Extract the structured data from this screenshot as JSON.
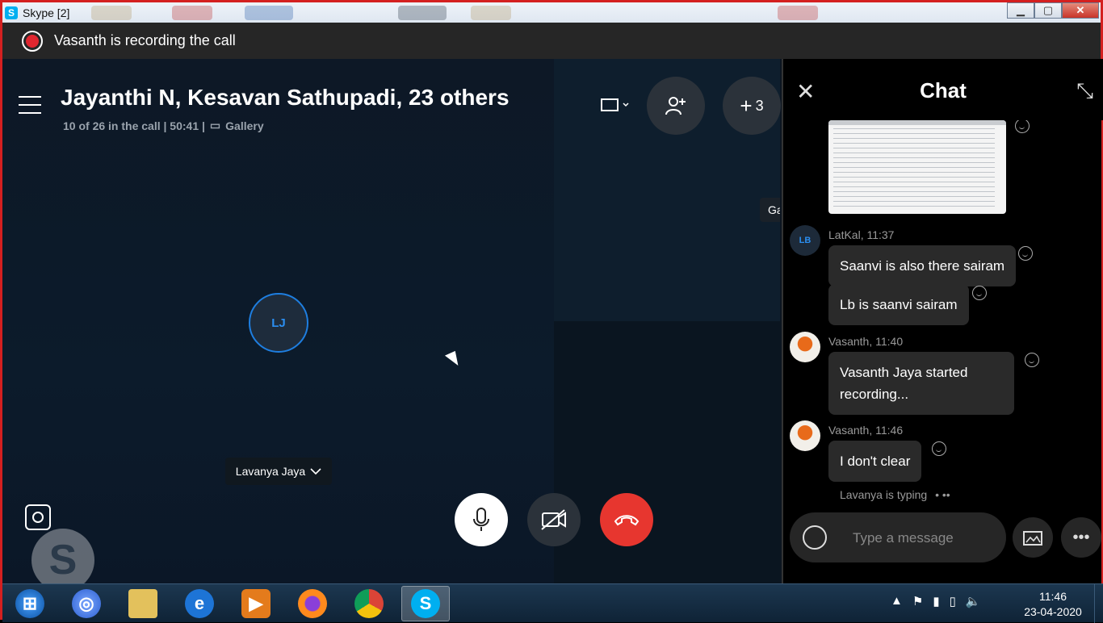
{
  "window": {
    "title": "Skype [2]",
    "minimize_label": "▁",
    "maximize_label": "▢",
    "close_label": "✕"
  },
  "recording": {
    "text": "Vasanth is recording the call"
  },
  "call": {
    "title": "Jayanthi N, Kesavan Sathupadi, 23 others",
    "participants_status": "10 of 26 in the call | 50:41 |",
    "view_mode": "Gallery",
    "extra_count": "3",
    "participant_initials": "LJ",
    "speaker_name": "Lavanya Jaya",
    "side_tile_label": "Ga"
  },
  "chat": {
    "title": "Chat",
    "messages": [
      {
        "author": "LatKal, 11:37",
        "avatar": "LB",
        "texts": [
          "Saanvi is also there sairam",
          "Lb is saanvi sairam"
        ]
      },
      {
        "author": "Vasanth, 11:40",
        "text_line1": "Vasanth Jaya started",
        "text_line2": "recording..."
      },
      {
        "author": "Vasanth, 11:46",
        "text": "I don't clear"
      }
    ],
    "typing": "Lavanya is typing",
    "input_placeholder": "Type a message"
  },
  "taskbar": {
    "time": "11:46",
    "date": "23-04-2020"
  },
  "colors": {
    "accent": "#00aff0",
    "end_call": "#e7362f",
    "recording": "#e0262f"
  }
}
